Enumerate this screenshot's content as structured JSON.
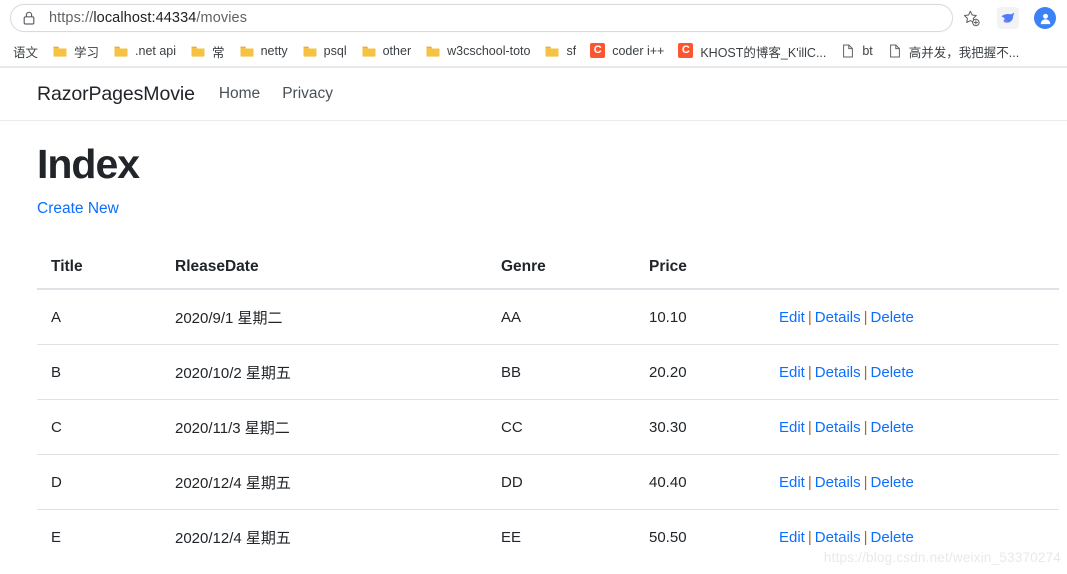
{
  "browser": {
    "omnibox": {
      "lock_icon": "lock-icon",
      "url_scheme": "https://",
      "url_host": "localhost:44334",
      "url_path": "/movies",
      "full_url": "https://localhost:44334/movies"
    },
    "toolbar_buttons": [
      {
        "name": "bookmark-star-icon",
        "label": ""
      },
      {
        "name": "extension-bird-icon",
        "label": ""
      },
      {
        "name": "profile-avatar-icon",
        "label": ""
      }
    ],
    "bookmarks": [
      {
        "label": "语文",
        "icon": "none"
      },
      {
        "label": "学习",
        "icon": "folder-icon"
      },
      {
        "label": ".net api",
        "icon": "folder-icon"
      },
      {
        "label": "常",
        "icon": "folder-icon"
      },
      {
        "label": "netty",
        "icon": "folder-icon"
      },
      {
        "label": "psql",
        "icon": "folder-icon"
      },
      {
        "label": "other",
        "icon": "folder-icon"
      },
      {
        "label": "w3cschool-toto",
        "icon": "folder-icon"
      },
      {
        "label": "sf",
        "icon": "folder-icon"
      },
      {
        "label": "coder i++",
        "icon": "csdn-icon"
      },
      {
        "label": "KHOST的博客_K'illC...",
        "icon": "csdn-icon"
      },
      {
        "label": "bt",
        "icon": "page-icon"
      },
      {
        "label": "高并发，我把握不...",
        "icon": "page-icon"
      }
    ]
  },
  "site": {
    "brand": "RazorPagesMovie",
    "nav_links": [
      {
        "label": "Home"
      },
      {
        "label": "Privacy"
      }
    ]
  },
  "main": {
    "title": "Index",
    "create_new_label": "Create New",
    "table": {
      "columns": [
        "Title",
        "RleaseDate",
        "Genre",
        "Price"
      ],
      "action_labels": {
        "edit": "Edit",
        "details": "Details",
        "delete": "Delete",
        "separator": "|"
      },
      "rows": [
        {
          "title": "A",
          "release_date": "2020/9/1 星期二",
          "genre": "AA",
          "price": "10.10"
        },
        {
          "title": "B",
          "release_date": "2020/10/2 星期五",
          "genre": "BB",
          "price": "20.20"
        },
        {
          "title": "C",
          "release_date": "2020/11/3 星期二",
          "genre": "CC",
          "price": "30.30"
        },
        {
          "title": "D",
          "release_date": "2020/12/4 星期五",
          "genre": "DD",
          "price": "40.40"
        },
        {
          "title": "E",
          "release_date": "2020/12/4 星期五",
          "genre": "EE",
          "price": "50.50"
        }
      ]
    }
  },
  "watermark": "https://blog.csdn.net/weixin_53370274",
  "colors": {
    "link": "#0d6efd",
    "separator": "#b5651d",
    "text": "#212529",
    "border": "#dee2e6",
    "csdn_orange": "#fc5531",
    "folder_yellow": "#f5c244",
    "avatar_blue": "#3b82f6"
  }
}
